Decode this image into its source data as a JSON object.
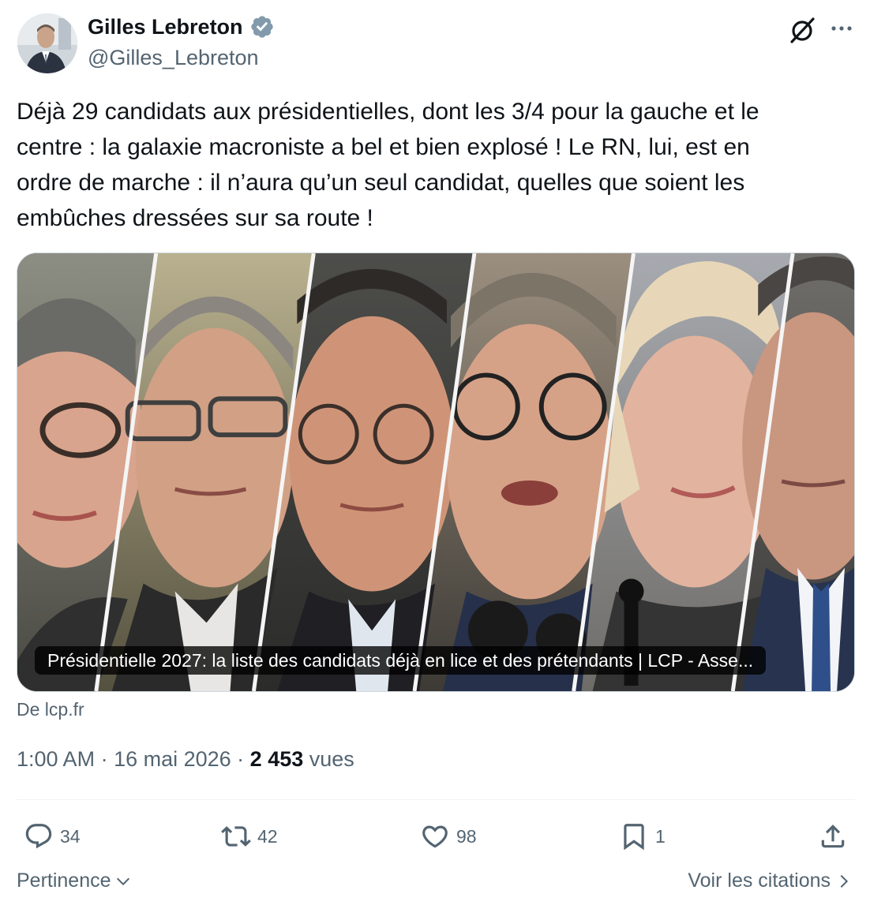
{
  "author": {
    "name": "Gilles Lebreton",
    "handle": "@Gilles_Lebreton",
    "verified": true
  },
  "tweet": {
    "text": "Déjà 29 candidats aux présidentielles, dont les 3/4 pour la gauche et le\ncentre : la galaxie macroniste a bel et bien explosé ! Le RN, lui, est en\nordre de marche : il n’aura qu’un seul candidat, quelles que soient les\nembûches dressées sur sa route !"
  },
  "card": {
    "caption": "Présidentielle 2027: la liste des candidats déjà en lice et des prétendants | LCP - Asse...",
    "source": "De lcp.fr"
  },
  "meta": {
    "time": "1:00 AM",
    "separator": " · ",
    "date": "16 mai 2026",
    "views_count": "2 453",
    "views_label": " vues"
  },
  "actions": {
    "replies": "34",
    "reposts": "42",
    "likes": "98",
    "bookmarks": "1"
  },
  "footer": {
    "sort_label": "Pertinence",
    "quotes_label": "Voir les citations"
  },
  "icons": [
    "verified-badge-icon",
    "grok-icon",
    "more-icon",
    "reply-icon",
    "repost-icon",
    "like-icon",
    "bookmark-icon",
    "share-icon",
    "chevron-down-icon",
    "chevron-right-icon"
  ],
  "colors": {
    "text": "#0f1419",
    "secondary": "#536471",
    "verified": "#829aab",
    "divider": "#eff3f4"
  }
}
